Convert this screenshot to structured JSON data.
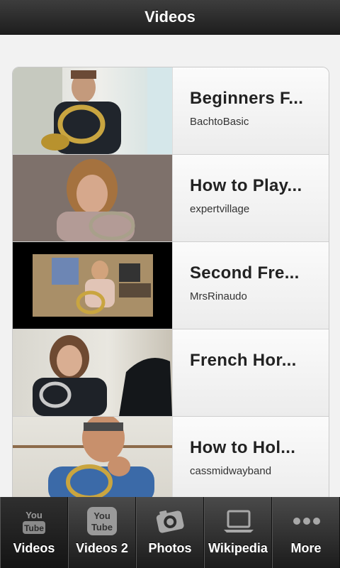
{
  "header": {
    "title": "Videos"
  },
  "videos": [
    {
      "title": "Beginners F...",
      "author": "BachtoBasic"
    },
    {
      "title": "How to Play...",
      "author": "expertvillage"
    },
    {
      "title": "Second Fre...",
      "author": "MrsRinaudo"
    },
    {
      "title": "French Hor...",
      "author": ""
    },
    {
      "title": "How to Hol...",
      "author": "cassmidwayband"
    }
  ],
  "tabs": [
    {
      "label": "Videos",
      "icon": "youtube-icon"
    },
    {
      "label": "Videos 2",
      "icon": "youtube-icon"
    },
    {
      "label": "Photos",
      "icon": "camera-icon"
    },
    {
      "label": "Wikipedia",
      "icon": "laptop-icon"
    },
    {
      "label": "More",
      "icon": "more-dots-icon"
    }
  ],
  "icon_text": {
    "you": "You",
    "tube": "Tube"
  }
}
